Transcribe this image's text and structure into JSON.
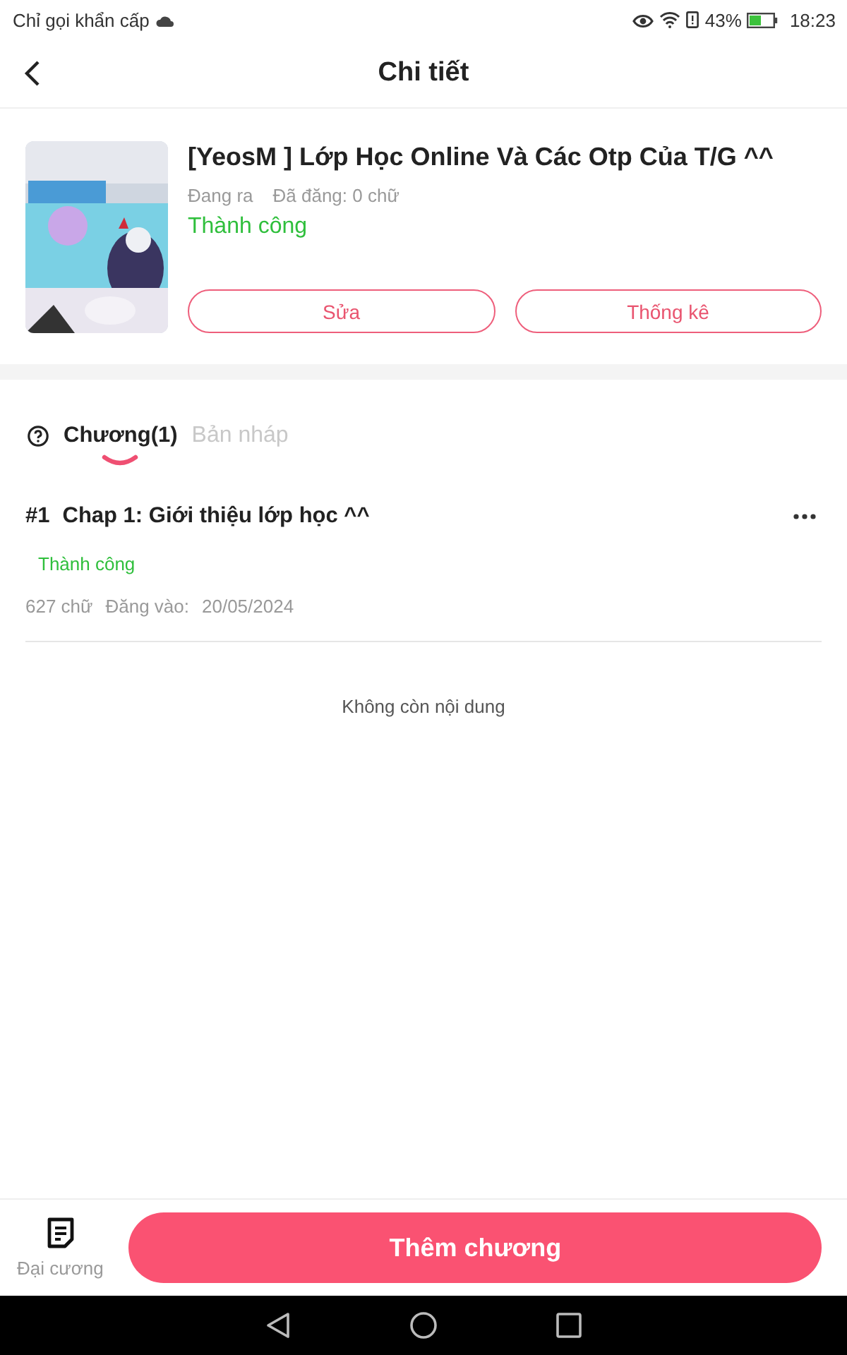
{
  "status_bar": {
    "carrier": "Chỉ gọi khẩn cấp",
    "battery": "43%",
    "time": "18:23"
  },
  "header": {
    "title": "Chi tiết"
  },
  "book": {
    "title": "[YeosM ] Lớp Học Online Và Các Otp Của T/G ^^",
    "status": "Đang ra",
    "word_count": "Đã đăng: 0 chữ",
    "review": "Thành công",
    "buttons": [
      "Sửa",
      "Thống kê"
    ]
  },
  "tabs": [
    {
      "label": "Chương(1)",
      "selected": true
    },
    {
      "label": "Bản nháp",
      "selected": false
    }
  ],
  "chapters": [
    {
      "number": "#1",
      "title": "Chap 1: Giới thiệu lớp học ^^",
      "review": "Thành công",
      "words": "627 chữ",
      "date_label": "Đăng vào:",
      "date": "20/05/2024"
    }
  ],
  "end_note": "Không còn nội dung",
  "bottom_bar": {
    "outline_label": "Đại cương",
    "add_button": "Thêm chương"
  }
}
